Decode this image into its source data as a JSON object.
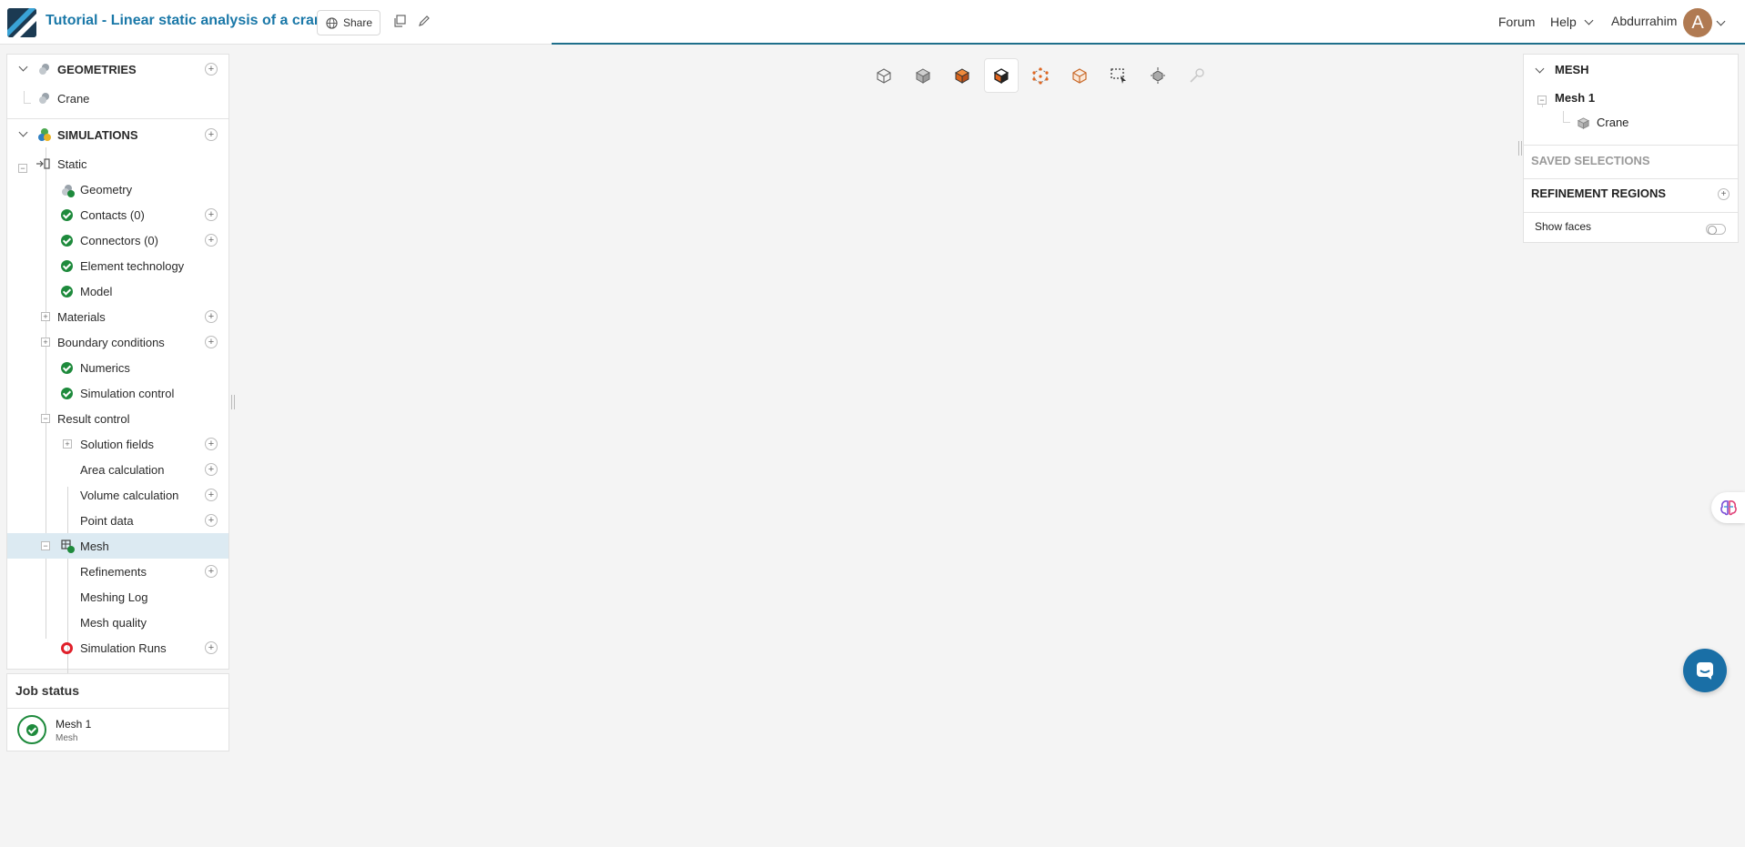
{
  "header": {
    "title": "Tutorial - Linear static analysis of a crane",
    "share_label": "Share",
    "forum_label": "Forum",
    "help_label": "Help",
    "user_name": "Abdurrahim",
    "avatar_initial": "A"
  },
  "tree": {
    "geometries_label": "GEOMETRIES",
    "geometry_item": "Crane",
    "simulations_label": "SIMULATIONS",
    "static_label": "Static",
    "items": {
      "geometry": "Geometry",
      "contacts": "Contacts (0)",
      "connectors": "Connectors (0)",
      "element_technology": "Element technology",
      "model": "Model",
      "materials": "Materials",
      "boundary_conditions": "Boundary conditions",
      "numerics": "Numerics",
      "simulation_control": "Simulation control",
      "result_control": "Result control",
      "solution_fields": "Solution fields",
      "area_calculation": "Area calculation",
      "volume_calculation": "Volume calculation",
      "point_data": "Point data",
      "mesh": "Mesh",
      "refinements": "Refinements",
      "meshing_log": "Meshing Log",
      "mesh_quality": "Mesh quality",
      "simulation_runs": "Simulation Runs"
    }
  },
  "job_status": {
    "title": "Job status",
    "job_name": "Mesh 1",
    "job_type": "Mesh",
    "state_icon": "check-circle"
  },
  "mesh_panel": {
    "header": "MESH",
    "mesh_item": "Mesh 1",
    "mesh_child": "Crane",
    "saved_selections": "SAVED SELECTIONS",
    "refinement_regions": "REFINEMENT REGIONS",
    "show_faces": "Show faces",
    "show_faces_on": false
  },
  "colors": {
    "accent": "#1a78a8",
    "success": "#1e8a3c",
    "error": "#e0202a",
    "selected_row": "#dceaf2",
    "chat_button": "#1a6fa6"
  }
}
